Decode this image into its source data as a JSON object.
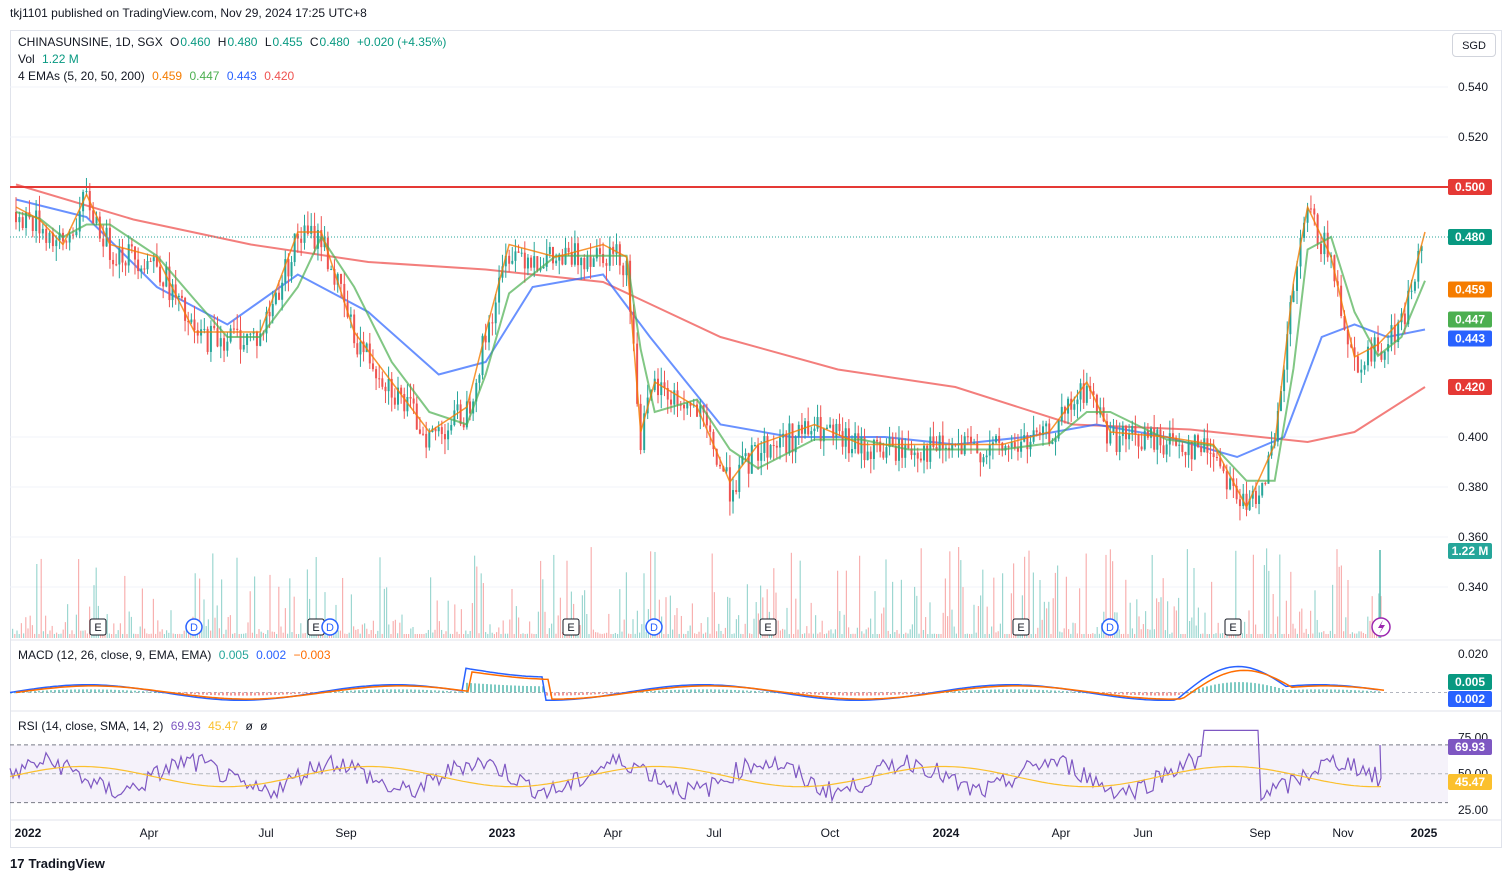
{
  "header": {
    "publisher": "tkj1101 published on TradingView.com, Nov 29, 2024 17:25 UTC+8"
  },
  "currency_button": "SGD",
  "legend": {
    "symbol": "CHINASUNSINE, 1D, SGX",
    "open_label": "O",
    "open": "0.460",
    "high_label": "H",
    "high": "0.480",
    "low_label": "L",
    "low": "0.455",
    "close_label": "C",
    "close": "0.480",
    "change": "+0.020 (+4.35%)",
    "vol_label": "Vol",
    "vol": "1.22 M",
    "ema_label": "4 EMAs (5, 20, 50, 200)",
    "ema5": "0.459",
    "ema20": "0.447",
    "ema50": "0.443",
    "ema200": "0.420",
    "macd_label": "MACD (12, 26, close, 9, EMA, EMA)",
    "macd_hist": "0.005",
    "macd_line": "0.002",
    "macd_signal": "−0.003",
    "rsi_label": "RSI (14, close, SMA, 14, 2)",
    "rsi": "69.93",
    "rsi_ma": "45.47",
    "rsi_u1": "ø",
    "rsi_u2": "ø"
  },
  "footer": {
    "brand": "TradingView",
    "mark": "17"
  },
  "colors": {
    "up": "#26a69a",
    "down": "#ef5350",
    "ema5": "#f57c00",
    "ema20": "#4caf50",
    "ema50": "#2962ff",
    "ema200": "#ef5350",
    "hline": "#e53935",
    "macd": "#2962ff",
    "signal": "#ff6d00",
    "rsi": "#7e57c2",
    "rsi_ma": "#fbc02d"
  },
  "chart_data": {
    "type": "candlestick",
    "symbol": "CHINASUNSINE",
    "exchange": "SGX",
    "interval": "1D",
    "currency": "SGD",
    "price_axis": [
      "0.540",
      "0.520",
      "0.500",
      "0.480",
      "0.459",
      "0.447",
      "0.443",
      "0.420",
      "0.400",
      "0.380",
      "0.360",
      "0.340"
    ],
    "price_ticks": [
      0.54,
      0.52,
      0.4,
      0.38,
      0.36,
      0.34
    ],
    "ylim": [
      0.33,
      0.55
    ],
    "time_axis": [
      "2022",
      "Apr",
      "Jul",
      "Sep",
      "2023",
      "Apr",
      "Jul",
      "Oct",
      "2024",
      "Apr",
      "Jun",
      "Sep",
      "Nov",
      "2025"
    ],
    "horizontal_line": 0.5,
    "horizontal_line_label": "0.500",
    "last_price": 0.48,
    "last_price_label": "0.480",
    "volume_label": "1.22 M",
    "ema_series": [
      {
        "name": "EMA 5",
        "period": 5,
        "last": 0.459
      },
      {
        "name": "EMA 20",
        "period": 20,
        "last": 0.447
      },
      {
        "name": "EMA 50",
        "period": 50,
        "last": 0.443
      },
      {
        "name": "EMA 200",
        "period": 200,
        "last": 0.42
      }
    ],
    "ema200_path": [
      [
        2022.0,
        0.501
      ],
      [
        2022.25,
        0.487
      ],
      [
        2022.5,
        0.477
      ],
      [
        2022.75,
        0.47
      ],
      [
        2023.0,
        0.467
      ],
      [
        2023.25,
        0.462
      ],
      [
        2023.5,
        0.44
      ],
      [
        2023.75,
        0.427
      ],
      [
        2024.0,
        0.42
      ],
      [
        2024.25,
        0.405
      ],
      [
        2024.5,
        0.403
      ],
      [
        2024.75,
        0.398
      ],
      [
        2024.85,
        0.402
      ],
      [
        2025.0,
        0.42
      ]
    ],
    "price_path": [
      [
        2022.0,
        0.49
      ],
      [
        2022.05,
        0.485
      ],
      [
        2022.1,
        0.475
      ],
      [
        2022.15,
        0.495
      ],
      [
        2022.2,
        0.475
      ],
      [
        2022.3,
        0.47
      ],
      [
        2022.38,
        0.44
      ],
      [
        2022.45,
        0.44
      ],
      [
        2022.52,
        0.44
      ],
      [
        2022.6,
        0.48
      ],
      [
        2022.65,
        0.48
      ],
      [
        2022.72,
        0.44
      ],
      [
        2022.8,
        0.42
      ],
      [
        2022.88,
        0.4
      ],
      [
        2022.96,
        0.41
      ],
      [
        2023.0,
        0.44
      ],
      [
        2023.05,
        0.475
      ],
      [
        2023.15,
        0.47
      ],
      [
        2023.25,
        0.475
      ],
      [
        2023.3,
        0.47
      ],
      [
        2023.33,
        0.4
      ],
      [
        2023.36,
        0.42
      ],
      [
        2023.45,
        0.41
      ],
      [
        2023.52,
        0.38
      ],
      [
        2023.58,
        0.395
      ],
      [
        2023.7,
        0.403
      ],
      [
        2023.8,
        0.395
      ],
      [
        2023.9,
        0.395
      ],
      [
        2024.0,
        0.395
      ],
      [
        2024.1,
        0.395
      ],
      [
        2024.2,
        0.4
      ],
      [
        2024.28,
        0.42
      ],
      [
        2024.33,
        0.4
      ],
      [
        2024.45,
        0.398
      ],
      [
        2024.55,
        0.395
      ],
      [
        2024.62,
        0.37
      ],
      [
        2024.68,
        0.395
      ],
      [
        2024.72,
        0.46
      ],
      [
        2024.75,
        0.49
      ],
      [
        2024.8,
        0.47
      ],
      [
        2024.85,
        0.43
      ],
      [
        2024.9,
        0.435
      ],
      [
        2024.95,
        0.445
      ],
      [
        2025.0,
        0.48
      ]
    ],
    "ema50_path": [
      [
        2022.0,
        0.495
      ],
      [
        2022.15,
        0.488
      ],
      [
        2022.3,
        0.46
      ],
      [
        2022.45,
        0.445
      ],
      [
        2022.6,
        0.465
      ],
      [
        2022.75,
        0.45
      ],
      [
        2022.9,
        0.425
      ],
      [
        2023.0,
        0.43
      ],
      [
        2023.1,
        0.46
      ],
      [
        2023.25,
        0.465
      ],
      [
        2023.35,
        0.44
      ],
      [
        2023.5,
        0.405
      ],
      [
        2023.65,
        0.4
      ],
      [
        2023.85,
        0.4
      ],
      [
        2024.0,
        0.397
      ],
      [
        2024.15,
        0.4
      ],
      [
        2024.3,
        0.405
      ],
      [
        2024.45,
        0.4
      ],
      [
        2024.6,
        0.392
      ],
      [
        2024.7,
        0.4
      ],
      [
        2024.78,
        0.44
      ],
      [
        2024.85,
        0.445
      ],
      [
        2024.92,
        0.44
      ],
      [
        2025.0,
        0.443
      ]
    ],
    "macd": {
      "hist": 0.005,
      "macd": 0.002,
      "signal": -0.003,
      "axis": [
        "0.020",
        "0.005",
        "0.002"
      ],
      "ylim": [
        -0.008,
        0.024
      ]
    },
    "rsi": {
      "value": 69.93,
      "ma": 45.47,
      "bands": [
        70,
        30
      ],
      "axis": [
        "75.00",
        "50.00",
        "25.00"
      ],
      "ylim": [
        20,
        90
      ]
    },
    "event_markers": [
      "E",
      "D",
      "E",
      "D",
      "E",
      "D",
      "E",
      "E",
      "D",
      "E"
    ]
  }
}
